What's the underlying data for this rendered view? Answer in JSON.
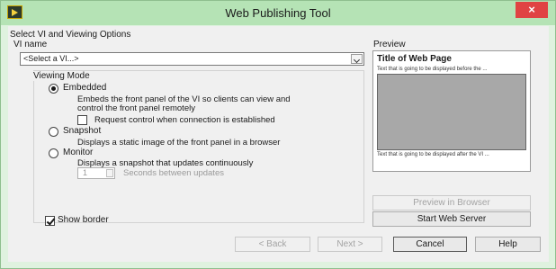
{
  "window": {
    "title": "Web Publishing Tool",
    "icon": "labview-run-icon",
    "close_glyph": "×"
  },
  "vi_section": {
    "heading": "Select VI and Viewing Options",
    "vi_name_label": "VI name",
    "vi_name_value": "<Select a VI...>"
  },
  "viewing_mode": {
    "label": "Viewing Mode",
    "embedded": {
      "label": "Embedded",
      "selected": true,
      "description_line1": "Embeds the front panel of the VI so clients can view and",
      "description_line2": "control the front panel remotely",
      "request_control_label": "Request control when connection is established",
      "request_control_checked": false
    },
    "snapshot": {
      "label": "Snapshot",
      "selected": false,
      "description": "Displays a static image of the front panel in a browser"
    },
    "monitor": {
      "label": "Monitor",
      "selected": false,
      "description": "Displays a snapshot that updates continuously",
      "seconds_value": "1",
      "seconds_label": "Seconds between updates"
    }
  },
  "preview": {
    "label": "Preview",
    "page_title": "Title of Web Page",
    "text_before": "Text that is going to be displayed before the ...",
    "text_after": "Text that is going to be displayed after the VI ..."
  },
  "show_border": {
    "label": "Show border",
    "checked": true
  },
  "buttons": {
    "preview_in_browser": "Preview in Browser",
    "start_web_server": "Start Web Server",
    "back": "< Back",
    "next": "Next >",
    "cancel": "Cancel",
    "help": "Help"
  },
  "colors": {
    "title_bar": "#b5e3b5",
    "window_frame": "#dff2df",
    "close_button": "#e04343"
  }
}
